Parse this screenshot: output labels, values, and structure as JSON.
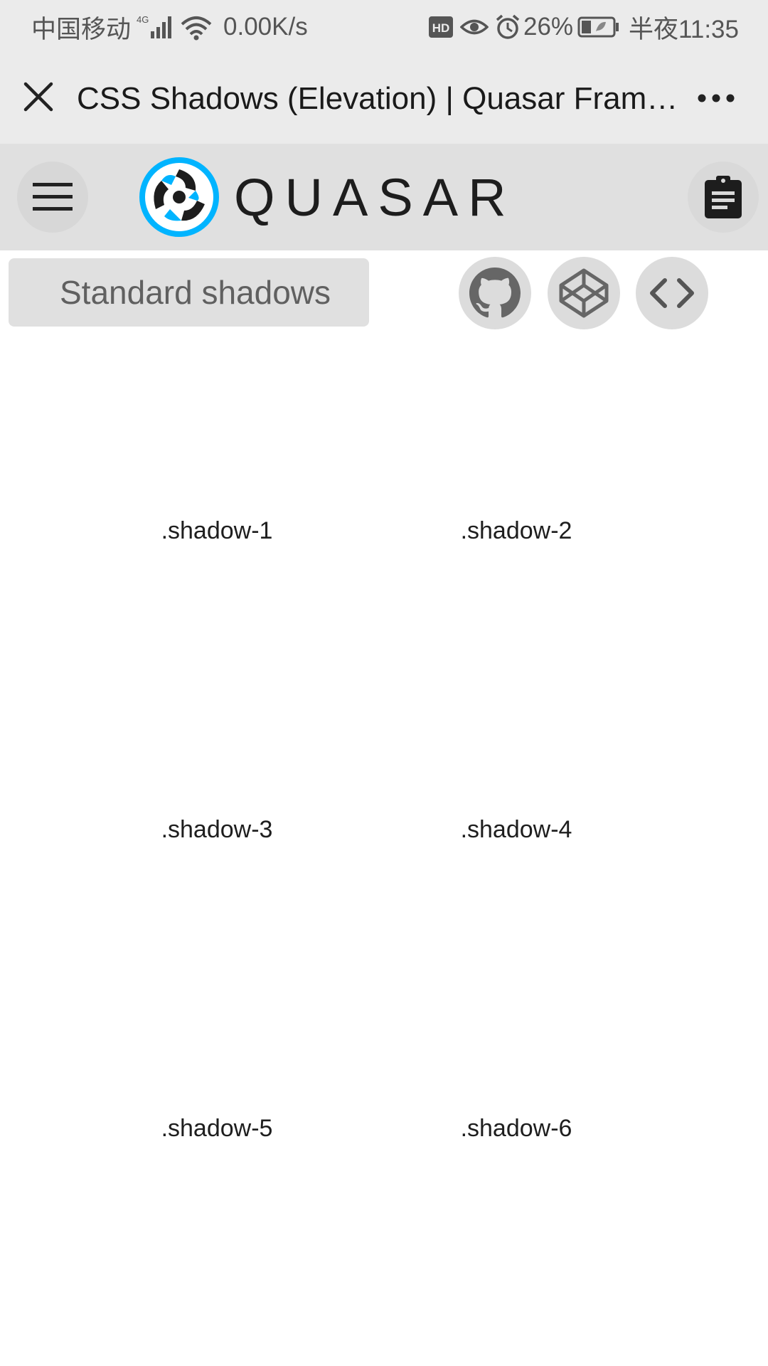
{
  "status_bar": {
    "carrier": "中国移动",
    "network_type": "4G",
    "speed": "0.00K/s",
    "hd_badge": "HD",
    "battery_percent": "26%",
    "time": "半夜11:35"
  },
  "title_bar": {
    "title": "CSS Shadows (Elevation) | Quasar Framework",
    "close_icon": "close-icon",
    "more_icon": "more-icon"
  },
  "header": {
    "logo_text": "QUASAR",
    "menu_icon": "menu-icon",
    "clipboard_icon": "clipboard-icon",
    "brand_color": "#00b4ff"
  },
  "section": {
    "title": "Standard shadows",
    "actions": [
      "github-icon",
      "codepen-icon",
      "code-icon"
    ]
  },
  "shadows": [
    ".shadow-1",
    ".shadow-2",
    ".shadow-3",
    ".shadow-4",
    ".shadow-5",
    ".shadow-6"
  ]
}
